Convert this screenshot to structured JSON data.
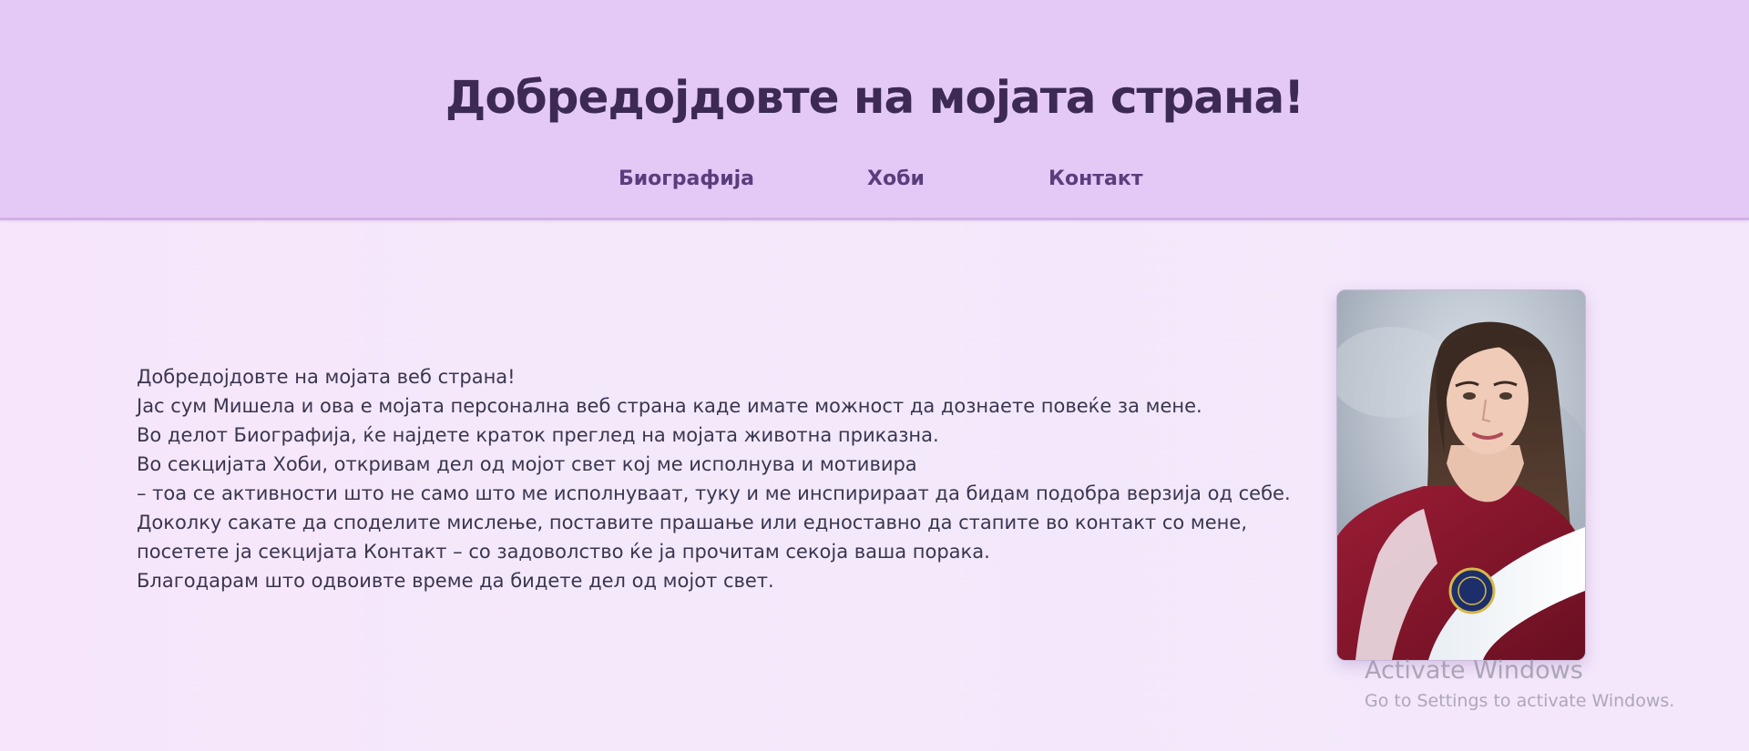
{
  "header": {
    "title": "Добредојдовте на мојата страна!",
    "nav": [
      {
        "label": "Биографија"
      },
      {
        "label": "Хоби"
      },
      {
        "label": "Контакт"
      }
    ]
  },
  "main": {
    "lines": [
      "Добредојдовте на мојата веб страна!",
      "Јас сум Мишела и ова е мојата персонална веб страна каде имате можност да дознаете повеќе за мене.",
      "Во делот Биографија, ќе најдете краток преглед на мојата животна приказна.",
      "Во секцијата Хоби, откривам дел од мојот свет кој ме исполнува и мотивира",
      "– тоа се активности што не само што ме исполнуваат, туку и ме инспирираат да бидам подобра верзија од себе.",
      "Доколку сакате да споделите мислење, поставите прашање или едноставно да стапите во контакт со мене,",
      "посетете ја секцијата Контакт – со задоволство ќе ја прочитам секоја ваша порака.",
      "Благодарам што одвоивте време да бидете дел од мојот свет."
    ]
  },
  "watermark": {
    "title": "Activate Windows",
    "subtitle": "Go to Settings to activate Windows."
  },
  "colors": {
    "header_bg": "#e4c8f6",
    "title": "#3c2a55",
    "nav_link": "#5a3d7c",
    "body_text": "#3a3650",
    "page_bg": "#f5e8fb"
  }
}
